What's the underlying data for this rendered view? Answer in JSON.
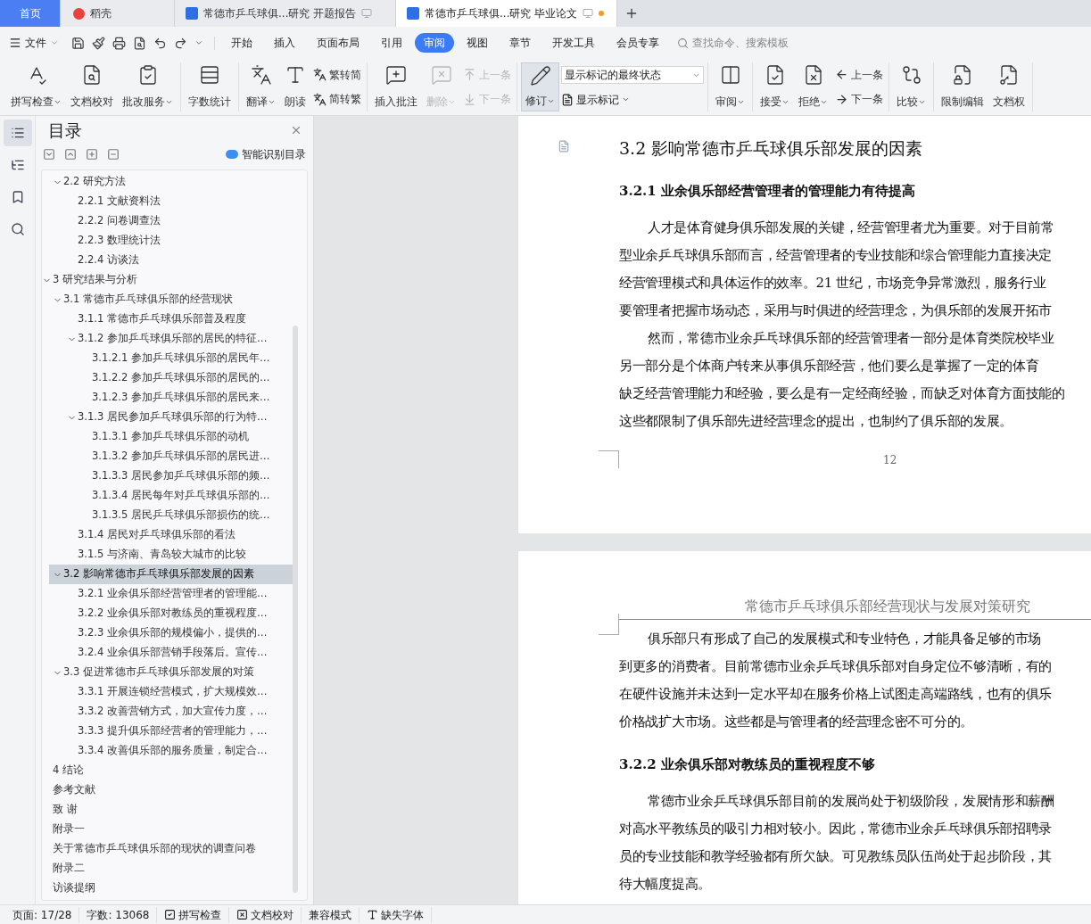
{
  "window_tabs": [
    {
      "kind": "home",
      "label": "首页",
      "selected": false
    },
    {
      "kind": "daoke",
      "label": "稻壳",
      "selected": false
    },
    {
      "kind": "doc",
      "label": "常德市乒乓球俱...研究 开题报告",
      "selected": false,
      "unsaved": false
    },
    {
      "kind": "doc",
      "label": "常德市乒乓球俱...研究 毕业论文",
      "selected": true,
      "unsaved": true
    }
  ],
  "menu": {
    "file_label": "文件",
    "ribbon_tabs": [
      {
        "label": "开始",
        "selected": false
      },
      {
        "label": "插入",
        "selected": false
      },
      {
        "label": "页面布局",
        "selected": false
      },
      {
        "label": "引用",
        "selected": false
      },
      {
        "label": "审阅",
        "selected": true
      },
      {
        "label": "视图",
        "selected": false
      },
      {
        "label": "章节",
        "selected": false
      },
      {
        "label": "开发工具",
        "selected": false
      },
      {
        "label": "会员专享",
        "selected": false
      }
    ],
    "search": {
      "placeholder": "查找命令、搜索模板"
    }
  },
  "ribbon": [
    [
      {
        "kind": "large",
        "label": "拼写检查",
        "caret": true
      },
      {
        "kind": "large",
        "label": "文档校对"
      },
      {
        "kind": "large",
        "label": "批改服务",
        "caret": true
      }
    ],
    [
      {
        "kind": "large",
        "label": "字数统计"
      }
    ],
    [
      {
        "kind": "large",
        "label": "翻译",
        "caret": true
      },
      {
        "kind": "large",
        "label": "朗读"
      },
      {
        "kind": "stack",
        "items": [
          {
            "label": "繁转简",
            "disabled": false
          },
          {
            "label": "简转繁",
            "disabled": false
          }
        ]
      }
    ],
    [
      {
        "kind": "large",
        "label": "插入批注"
      },
      {
        "kind": "large",
        "label": "删除",
        "caret": true,
        "disabled": true
      },
      {
        "kind": "stack",
        "items": [
          {
            "label": "上一条",
            "disabled": true
          },
          {
            "label": "下一条",
            "disabled": true
          }
        ]
      }
    ],
    [
      {
        "kind": "large",
        "label": "修订",
        "caret": true,
        "on": true
      },
      {
        "kind": "select",
        "value": "显示标记的最终状态",
        "below": "显示标记"
      }
    ],
    [
      {
        "kind": "large",
        "label": "审阅",
        "caret": true
      }
    ],
    [
      {
        "kind": "large",
        "label": "接受",
        "caret": true
      },
      {
        "kind": "large",
        "label": "拒绝",
        "caret": true
      },
      {
        "kind": "stack",
        "items": [
          {
            "label": "上一条",
            "disabled": false
          },
          {
            "label": "下一条",
            "disabled": false
          }
        ]
      }
    ],
    [
      {
        "kind": "large",
        "label": "比较",
        "caret": true
      }
    ],
    [
      {
        "kind": "large",
        "label": "限制编辑"
      },
      {
        "kind": "large",
        "label": "文档权"
      }
    ]
  ],
  "sidebar": {
    "rail": [
      {
        "selected": true
      },
      {
        "selected": false
      },
      {
        "selected": false
      },
      {
        "selected": false
      }
    ],
    "title": "目录",
    "smart_button": "智能识别目录",
    "items": [
      {
        "children": [
          {
            "label": "2.2 研究方法",
            "expanded": true,
            "selected": false,
            "children": [
              {
                "label": "2.2.1 文献资料法",
                "selected": false
              },
              {
                "label": "2.2.2 问卷调查法",
                "selected": false
              },
              {
                "label": "2.2.3 数理统计法",
                "selected": false
              },
              {
                "label": "2.2.4 访谈法",
                "selected": false
              }
            ]
          }
        ]
      },
      {
        "label": "3  研究结果与分析",
        "expanded": true,
        "selected": false,
        "children": [
          {
            "label": "3.1  常德市乒乓球俱乐部的经营现状",
            "expanded": true,
            "selected": false,
            "children": [
              {
                "label": "3.1.1  常德市乒乓球俱乐部普及程度",
                "selected": false
              },
              {
                "label": "3.1.2  参加乒乓球俱乐部的居民的特征…",
                "expanded": true,
                "selected": false,
                "children": [
                  {
                    "label": "3.1.2.1  参加乒乓球俱乐部的居民年…",
                    "selected": false
                  },
                  {
                    "label": "3.1.2.2  参加乒乓球俱乐部的居民的…",
                    "selected": false
                  },
                  {
                    "label": "3.1.2.3  参加乒乓球俱乐部的居民来…",
                    "selected": false
                  }
                ]
              },
              {
                "label": "3.1.3  居民参加乒乓球俱乐部的行为特…",
                "expanded": true,
                "selected": false,
                "children": [
                  {
                    "label": "3.1.3.1  参加乒乓球俱乐部的动机",
                    "selected": false
                  },
                  {
                    "label": "3.1.3.2  参加乒乓球俱乐部的居民进…",
                    "selected": false
                  },
                  {
                    "label": "3.1.3.3 居民参加乒乓球俱乐部的频…",
                    "selected": false
                  },
                  {
                    "label": "3.1.3.4  居民每年对乒乓球俱乐部的…",
                    "selected": false
                  },
                  {
                    "label": "3.1.3.5  居民乒乓球俱乐部损伤的统…",
                    "selected": false
                  }
                ]
              },
              {
                "label": "3.1.4  居民对乒乓球俱乐部的看法",
                "selected": false
              },
              {
                "label": "3.1.5 与济南、青岛较大城市的比较",
                "selected": false
              }
            ]
          },
          {
            "label": "3.2  影响常德市乒乓球俱乐部发展的因素",
            "expanded": true,
            "selected": true,
            "children": [
              {
                "label": "3.2.1 业余俱乐部经营管理者的管理能…",
                "selected": false
              },
              {
                "label": "3.2.2 业余俱乐部对教练员的重视程度…",
                "selected": false
              },
              {
                "label": "3.2.3 业余俱乐部的规模偏小，提供的…",
                "selected": false
              },
              {
                "label": "3.2.4 业余俱乐部营销手段落后。宣传…",
                "selected": false
              }
            ]
          },
          {
            "label": "3.3  促进常德市乒乓球俱乐部发展的对策",
            "expanded": true,
            "selected": false,
            "children": [
              {
                "label": "3.3.1 开展连锁经营模式，扩大规模效…",
                "selected": false
              },
              {
                "label": "3.3.2 改善营销方式，加大宣传力度，…",
                "selected": false
              },
              {
                "label": "3.3.3 提升俱乐部经营者的管理能力，…",
                "selected": false
              },
              {
                "label": "3.3.4 改善俱乐部的服务质量，制定合…",
                "selected": false
              }
            ]
          }
        ]
      },
      {
        "label": "4  结论",
        "selected": false
      },
      {
        "label": "参考文献",
        "selected": false
      },
      {
        "label": "致    谢",
        "selected": false
      },
      {
        "label": "附录一",
        "selected": false
      },
      {
        "label": "关于常德市乒乓球俱乐部的现状的调查问卷",
        "selected": false
      },
      {
        "label": "附录二",
        "selected": false
      },
      {
        "label": "访谈提纲",
        "selected": false
      }
    ]
  },
  "document": {
    "pages": [
      {
        "heading": "3.2  影响常德市乒乓球俱乐部发展的因素",
        "page_number": "12",
        "blocks": [
          {
            "kind": "subheading",
            "text": "3.2.1 业余俱乐部经营管理者的管理能力有待提高"
          },
          {
            "kind": "paragraph",
            "lines": [
              "人才是体育健身俱乐部发展的关键，经营管理者尤为重要。对于目前常",
              "型业余乒乓球俱乐部而言，经营管理者的专业技能和综合管理能力直接决定",
              "经营管理模式和具体运作的效率。21 世纪，市场竞争异常激烈，服务行业",
              "要管理者把握市场动态，采用与时俱进的经营理念，为俱乐部的发展开拓市"
            ]
          },
          {
            "kind": "paragraph",
            "lines": [
              "然而，常德市业余乒乓球俱乐部的经营管理者一部分是体育类院校毕业",
              "另一部分是个体商户转来从事俱乐部经营，他们要么是掌握了一定的体育",
              "缺乏经营管理能力和经验，要么是有一定经商经验，而缺乏对体育方面技能的",
              "这些都限制了俱乐部先进经营理念的提出，也制约了俱乐部的发展。"
            ]
          }
        ]
      },
      {
        "header": "常德市乒乓球俱乐部经营现状与发展对策研究",
        "blocks": [
          {
            "kind": "paragraph",
            "lines": [
              "俱乐部只有形成了自己的发展模式和专业特色，才能具备足够的市场",
              "到更多的消费者。目前常德市业余乒乓球俱乐部对自身定位不够清晰，有的",
              "在硬件设施并未达到一定水平却在服务价格上试图走高端路线，也有的俱乐",
              "价格战扩大市场。这些都是与管理者的经营理念密不可分的。"
            ]
          },
          {
            "kind": "subheading",
            "text": "3.2.2 业余俱乐部对教练员的重视程度不够"
          },
          {
            "kind": "paragraph",
            "lines": [
              "常德市业余乒乓球俱乐部目前的发展尚处于初级阶段，发展情形和薪酬",
              "对高水平教练员的吸引力相对较小。因此，常德市业余乒乓球俱乐部招聘录",
              "员的专业技能和教学经验都有所欠缺。可见教练员队伍尚处于起步阶段，其",
              "待大幅度提高。"
            ]
          }
        ]
      }
    ]
  },
  "status_bar": [
    {
      "kind": "text",
      "label": "页面: 17/28"
    },
    {
      "kind": "text",
      "label": "字数: 13068"
    },
    {
      "kind": "icon",
      "label": "拼写检查"
    },
    {
      "kind": "icon",
      "label": "文档校对"
    },
    {
      "kind": "text",
      "label": "兼容模式"
    },
    {
      "kind": "icon",
      "label": "缺失字体"
    }
  ]
}
